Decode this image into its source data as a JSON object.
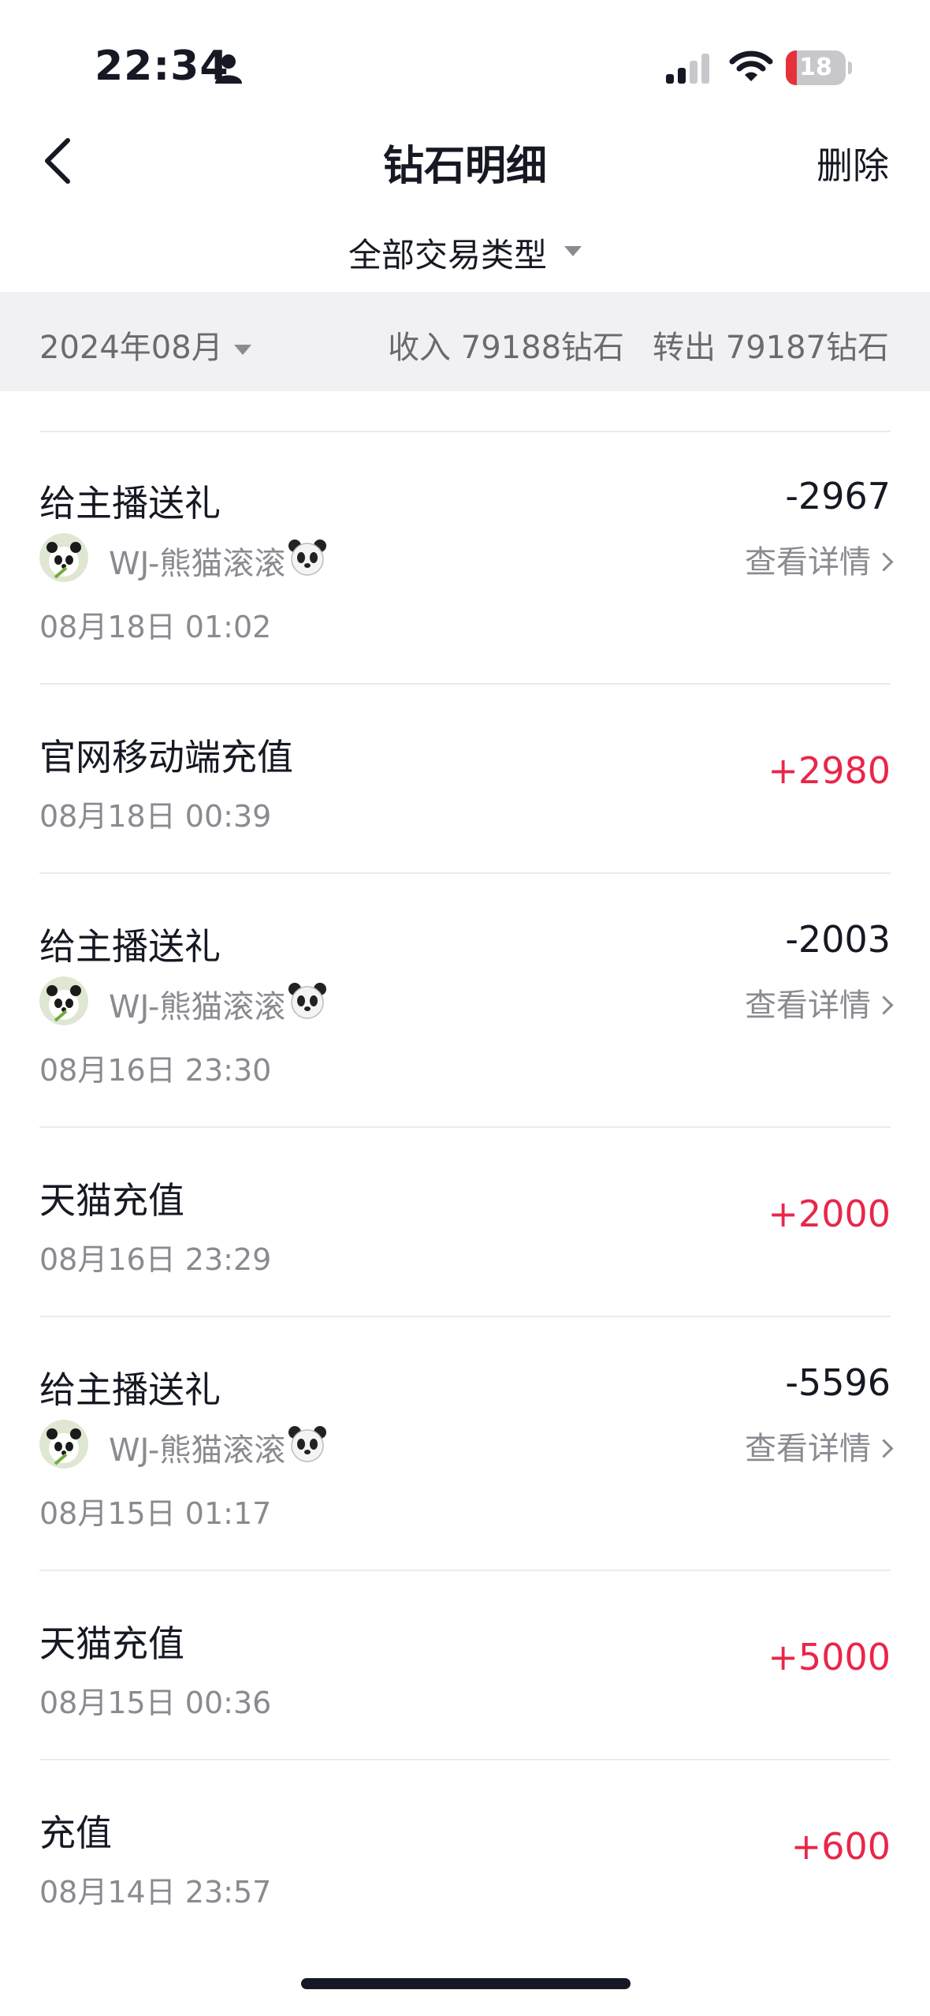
{
  "status_bar": {
    "time": "22:34",
    "battery": "18",
    "battery_level": 0.18
  },
  "nav": {
    "title": "钻石明细",
    "action": "删除"
  },
  "filter": {
    "label": "全部交易类型"
  },
  "summary": {
    "month": "2024年08月",
    "income": "收入 79188钻石",
    "outgo": "转出 79187钻石"
  },
  "colors": {
    "positive": "#e9264a",
    "negative": "#161823",
    "secondary": "#8a8b91"
  },
  "transactions": [
    {
      "title": "给主播送礼",
      "amount": "-2967",
      "anchor_name": "WJ-熊猫滚滚",
      "detail": "查看详情",
      "date": "08月18日 01:02"
    },
    {
      "title": "官网移动端充值",
      "amount": "+2980",
      "date": "08月18日 00:39"
    },
    {
      "title": "给主播送礼",
      "amount": "-2003",
      "anchor_name": "WJ-熊猫滚滚",
      "detail": "查看详情",
      "date": "08月16日 23:30"
    },
    {
      "title": "天猫充值",
      "amount": "+2000",
      "date": "08月16日 23:29"
    },
    {
      "title": "给主播送礼",
      "amount": "-5596",
      "anchor_name": "WJ-熊猫滚滚",
      "detail": "查看详情",
      "date": "08月15日 01:17"
    },
    {
      "title": "天猫充值",
      "amount": "+5000",
      "date": "08月15日 00:36"
    },
    {
      "title": "充值",
      "amount": "+600",
      "date": "08月14日 23:57"
    }
  ]
}
